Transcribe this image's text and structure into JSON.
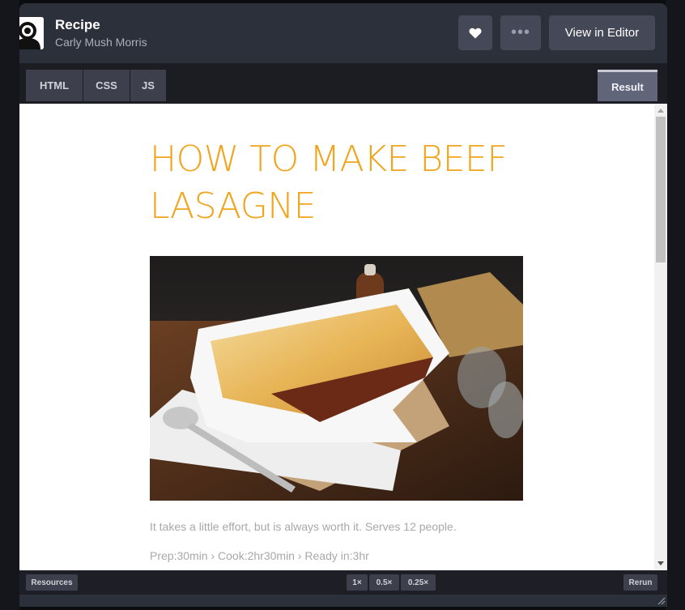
{
  "header": {
    "title": "Recipe",
    "author": "Carly Mush Morris",
    "view_in_editor": "View in Editor",
    "heart_icon": "heart-icon",
    "more_icon": "more-icon",
    "more_label": "•••"
  },
  "tabs": {
    "html": "HTML",
    "css": "CSS",
    "js": "JS",
    "result": "Result"
  },
  "result": {
    "heading": "HOW TO MAKE BEEF LASAGNE",
    "intro": "It takes a little effort, but is always worth it. Serves 12 people.",
    "times": "Prep:30min › Cook:2hr30min › Ready in:3hr"
  },
  "footer": {
    "resources": "Resources",
    "zoom": [
      "1×",
      "0.5×",
      "0.25×"
    ],
    "rerun": "Rerun"
  },
  "colors": {
    "accent": "#f0a51c",
    "bar": "#2c303a",
    "button": "#444857"
  }
}
